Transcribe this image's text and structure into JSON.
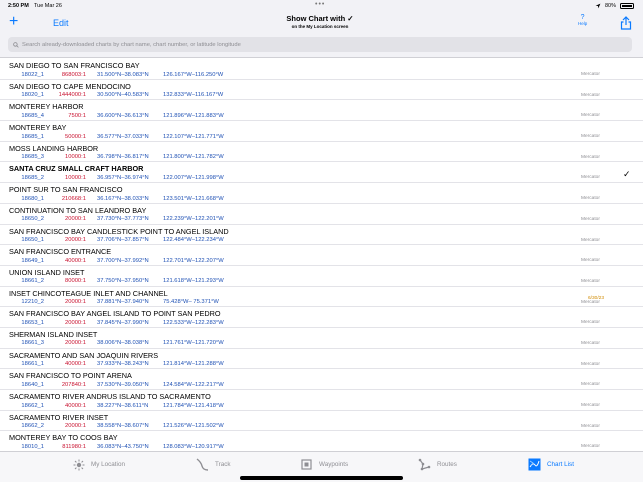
{
  "status_bar": {
    "time": "2:50 PM",
    "date": "Tue Mar 26",
    "battery": "80%"
  },
  "navbar": {
    "add_label": "+",
    "edit_label": "Edit",
    "title": "Show Chart with",
    "subtitle": "on the My Location screen",
    "help_symbol": "?",
    "help_label": "Help"
  },
  "search": {
    "placeholder": "Search already-downloaded charts by chart name, chart number, or latitude longitude"
  },
  "charts": [
    {
      "name": "SAN DIEGO TO SAN FRANCISCO BAY",
      "number": "18022_1",
      "scale": "868003:1",
      "lat": "31.500°N–38.083°N",
      "lon": "126.167°W–116.250°W",
      "projection": "Mercator",
      "date": "",
      "selected": false
    },
    {
      "name": "SAN DIEGO TO CAPE MENDOCINO",
      "number": "18020_1",
      "scale": "1444000:1",
      "lat": "30.500°N–40.583°N",
      "lon": "132.833°W–116.167°W",
      "projection": "Mercator",
      "date": "",
      "selected": false
    },
    {
      "name": "MONTEREY HARBOR",
      "number": "18685_4",
      "scale": "7500:1",
      "lat": "36.600°N–36.613°N",
      "lon": "121.896°W–121.883°W",
      "projection": "Mercator",
      "date": "",
      "selected": false
    },
    {
      "name": "MONTEREY BAY",
      "number": "18685_1",
      "scale": "50000:1",
      "lat": "36.577°N–37.033°N",
      "lon": "122.107°W–121.771°W",
      "projection": "Mercator",
      "date": "",
      "selected": false
    },
    {
      "name": "MOSS LANDING HARBOR",
      "number": "18685_3",
      "scale": "10000:1",
      "lat": "36.798°N–36.817°N",
      "lon": "121.800°W–121.782°W",
      "projection": "Mercator",
      "date": "",
      "selected": false
    },
    {
      "name": "SANTA CRUZ SMALL CRAFT HARBOR",
      "number": "18685_2",
      "scale": "10000:1",
      "lat": "36.957°N–36.974°N",
      "lon": "122.007°W–121.998°W",
      "projection": "Mercator",
      "date": "",
      "selected": true,
      "check": "✓"
    },
    {
      "name": "POINT SUR TO SAN FRANCISCO",
      "number": "18680_1",
      "scale": "210668:1",
      "lat": "36.167°N–38.033°N",
      "lon": "123.501°W–121.668°W",
      "projection": "Mercator",
      "date": "",
      "selected": false
    },
    {
      "name": "CONTINUATION TO SAN LEANDRO BAY",
      "number": "18650_2",
      "scale": "20000:1",
      "lat": "37.730°N–37.773°N",
      "lon": "122.239°W–122.201°W",
      "projection": "Mercator",
      "date": "",
      "selected": false
    },
    {
      "name": "SAN FRANCISCO BAY CANDLESTICK POINT TO ANGEL ISLAND",
      "number": "18650_1",
      "scale": "20000:1",
      "lat": "37.706°N–37.857°N",
      "lon": "122.484°W–122.234°W",
      "projection": "Mercator",
      "date": "",
      "selected": false
    },
    {
      "name": "SAN FRANCISCO ENTRANCE",
      "number": "18649_1",
      "scale": "40000:1",
      "lat": "37.700°N–37.992°N",
      "lon": "122.701°W–122.207°W",
      "projection": "Mercator",
      "date": "",
      "selected": false
    },
    {
      "name": "UNION ISLAND INSET",
      "number": "18661_2",
      "scale": "80000:1",
      "lat": "37.750°N–37.950°N",
      "lon": "121.618°W–121.293°W",
      "projection": "Mercator",
      "date": "",
      "selected": false
    },
    {
      "name": "INSET CHINCOTEAGUE INLET AND CHANNEL",
      "number": "12210_2",
      "scale": "20000:1",
      "lat": "37.881°N–37.940°N",
      "lon": "75.428°W– 75.371°W",
      "projection": "Mercator",
      "date": "6/30/23",
      "selected": false
    },
    {
      "name": "SAN FRANCISCO BAY  ANGEL ISLAND TO POINT SAN PEDRO",
      "number": "18653_1",
      "scale": "20000:1",
      "lat": "37.845°N–37.990°N",
      "lon": "122.533°W–122.283°W",
      "projection": "Mercator",
      "date": "",
      "selected": false
    },
    {
      "name": "SHERMAN ISLAND INSET",
      "number": "18661_3",
      "scale": "20000:1",
      "lat": "38.006°N–38.038°N",
      "lon": "121.761°W–121.720°W",
      "projection": "Mercator",
      "date": "",
      "selected": false
    },
    {
      "name": "SACRAMENTO AND SAN JOAQUIN RIVERS",
      "number": "18661_1",
      "scale": "40000:1",
      "lat": "37.933°N–38.243°N",
      "lon": "121.814°W–121.288°W",
      "projection": "Mercator",
      "date": "",
      "selected": false
    },
    {
      "name": "SAN FRANCISCO TO POINT ARENA",
      "number": "18640_1",
      "scale": "207840:1",
      "lat": "37.530°N–39.050°N",
      "lon": "124.584°W–122.217°W",
      "projection": "Mercator",
      "date": "",
      "selected": false
    },
    {
      "name": "SACRAMENTO RIVER ANDRUS ISLAND TO SACRAMENTO",
      "number": "18662_1",
      "scale": "40000:1",
      "lat": "38.227°N–38.611°N",
      "lon": "121.784°W–121.418°W",
      "projection": "Mercator",
      "date": "",
      "selected": false
    },
    {
      "name": "SACRAMENTO RIVER INSET",
      "number": "18662_2",
      "scale": "20000:1",
      "lat": "38.558°N–38.607°N",
      "lon": "121.526°W–121.502°W",
      "projection": "Mercator",
      "date": "",
      "selected": false
    },
    {
      "name": "MONTEREY BAY TO COOS BAY",
      "number": "18010_1",
      "scale": "811980:1",
      "lat": "36.083°N–43.750°N",
      "lon": "128.083°W–120.917°W",
      "projection": "Mercator",
      "date": "",
      "selected": false
    }
  ],
  "tabs": [
    {
      "label": "My Location",
      "icon": "sun-location-icon",
      "active": false
    },
    {
      "label": "Track",
      "icon": "track-icon",
      "active": false
    },
    {
      "label": "Waypoints",
      "icon": "waypoint-icon",
      "active": false
    },
    {
      "label": "Routes",
      "icon": "routes-icon",
      "active": false
    },
    {
      "label": "Chart List",
      "icon": "chart-list-icon",
      "active": true
    }
  ],
  "colors": {
    "accent": "#0a7aff",
    "chart_number": "#1e50b4",
    "scale": "#c8102e",
    "date": "#d08a00"
  }
}
